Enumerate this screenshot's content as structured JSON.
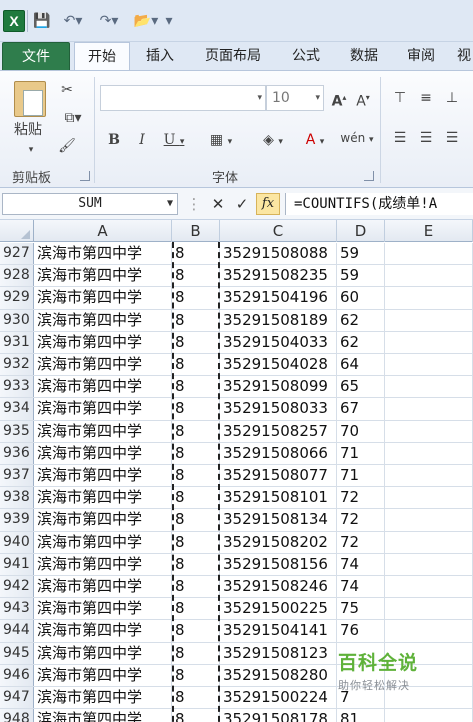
{
  "qat": {
    "app_icon": "X",
    "icons": [
      "save-icon",
      "undo-icon",
      "redo-icon",
      "open-icon",
      "customize-icon"
    ]
  },
  "tabs": [
    "文件",
    "开始",
    "插入",
    "页面布局",
    "公式",
    "数据",
    "审阅",
    "视"
  ],
  "ribbon": {
    "paste_label": "粘贴",
    "clipboard_label": "剪贴板",
    "font_group_label": "字体",
    "font_size": "10"
  },
  "formula_bar": {
    "name_box": "SUM",
    "fx": "fx",
    "formula": "=COUNTIFS(成绩单!A"
  },
  "columns": [
    "A",
    "B",
    "C",
    "D",
    "E"
  ],
  "rows": [
    {
      "n": "927",
      "a": "滨海市第四中学",
      "b": "8",
      "c": "35291508088",
      "d": "59"
    },
    {
      "n": "928",
      "a": "滨海市第四中学",
      "b": "8",
      "c": "35291508235",
      "d": "59"
    },
    {
      "n": "929",
      "a": "滨海市第四中学",
      "b": "8",
      "c": "35291504196",
      "d": "60"
    },
    {
      "n": "930",
      "a": "滨海市第四中学",
      "b": "8",
      "c": "35291508189",
      "d": "62"
    },
    {
      "n": "931",
      "a": "滨海市第四中学",
      "b": "8",
      "c": "35291504033",
      "d": "62"
    },
    {
      "n": "932",
      "a": "滨海市第四中学",
      "b": "8",
      "c": "35291504028",
      "d": "64"
    },
    {
      "n": "933",
      "a": "滨海市第四中学",
      "b": "8",
      "c": "35291508099",
      "d": "65"
    },
    {
      "n": "934",
      "a": "滨海市第四中学",
      "b": "8",
      "c": "35291508033",
      "d": "67"
    },
    {
      "n": "935",
      "a": "滨海市第四中学",
      "b": "8",
      "c": "35291508257",
      "d": "70"
    },
    {
      "n": "936",
      "a": "滨海市第四中学",
      "b": "8",
      "c": "35291508066",
      "d": "71"
    },
    {
      "n": "937",
      "a": "滨海市第四中学",
      "b": "8",
      "c": "35291508077",
      "d": "71"
    },
    {
      "n": "938",
      "a": "滨海市第四中学",
      "b": "8",
      "c": "35291508101",
      "d": "72"
    },
    {
      "n": "939",
      "a": "滨海市第四中学",
      "b": "8",
      "c": "35291508134",
      "d": "72"
    },
    {
      "n": "940",
      "a": "滨海市第四中学",
      "b": "8",
      "c": "35291508202",
      "d": "72"
    },
    {
      "n": "941",
      "a": "滨海市第四中学",
      "b": "8",
      "c": "35291508156",
      "d": "74"
    },
    {
      "n": "942",
      "a": "滨海市第四中学",
      "b": "8",
      "c": "35291508246",
      "d": "74"
    },
    {
      "n": "943",
      "a": "滨海市第四中学",
      "b": "8",
      "c": "35291500225",
      "d": "75"
    },
    {
      "n": "944",
      "a": "滨海市第四中学",
      "b": "8",
      "c": "35291504141",
      "d": "76"
    },
    {
      "n": "945",
      "a": "滨海市第四中学",
      "b": "8",
      "c": "35291508123",
      "d": ""
    },
    {
      "n": "946",
      "a": "滨海市第四中学",
      "b": "8",
      "c": "35291508280",
      "d": ""
    },
    {
      "n": "947",
      "a": "滨海市第四中学",
      "b": "8",
      "c": "35291500224",
      "d": "7"
    },
    {
      "n": "948",
      "a": "滨海市第四中学",
      "b": "8",
      "c": "35291508178",
      "d": "81"
    }
  ],
  "watermark": {
    "title": "百科全说",
    "subtitle": "助你轻松解决"
  }
}
